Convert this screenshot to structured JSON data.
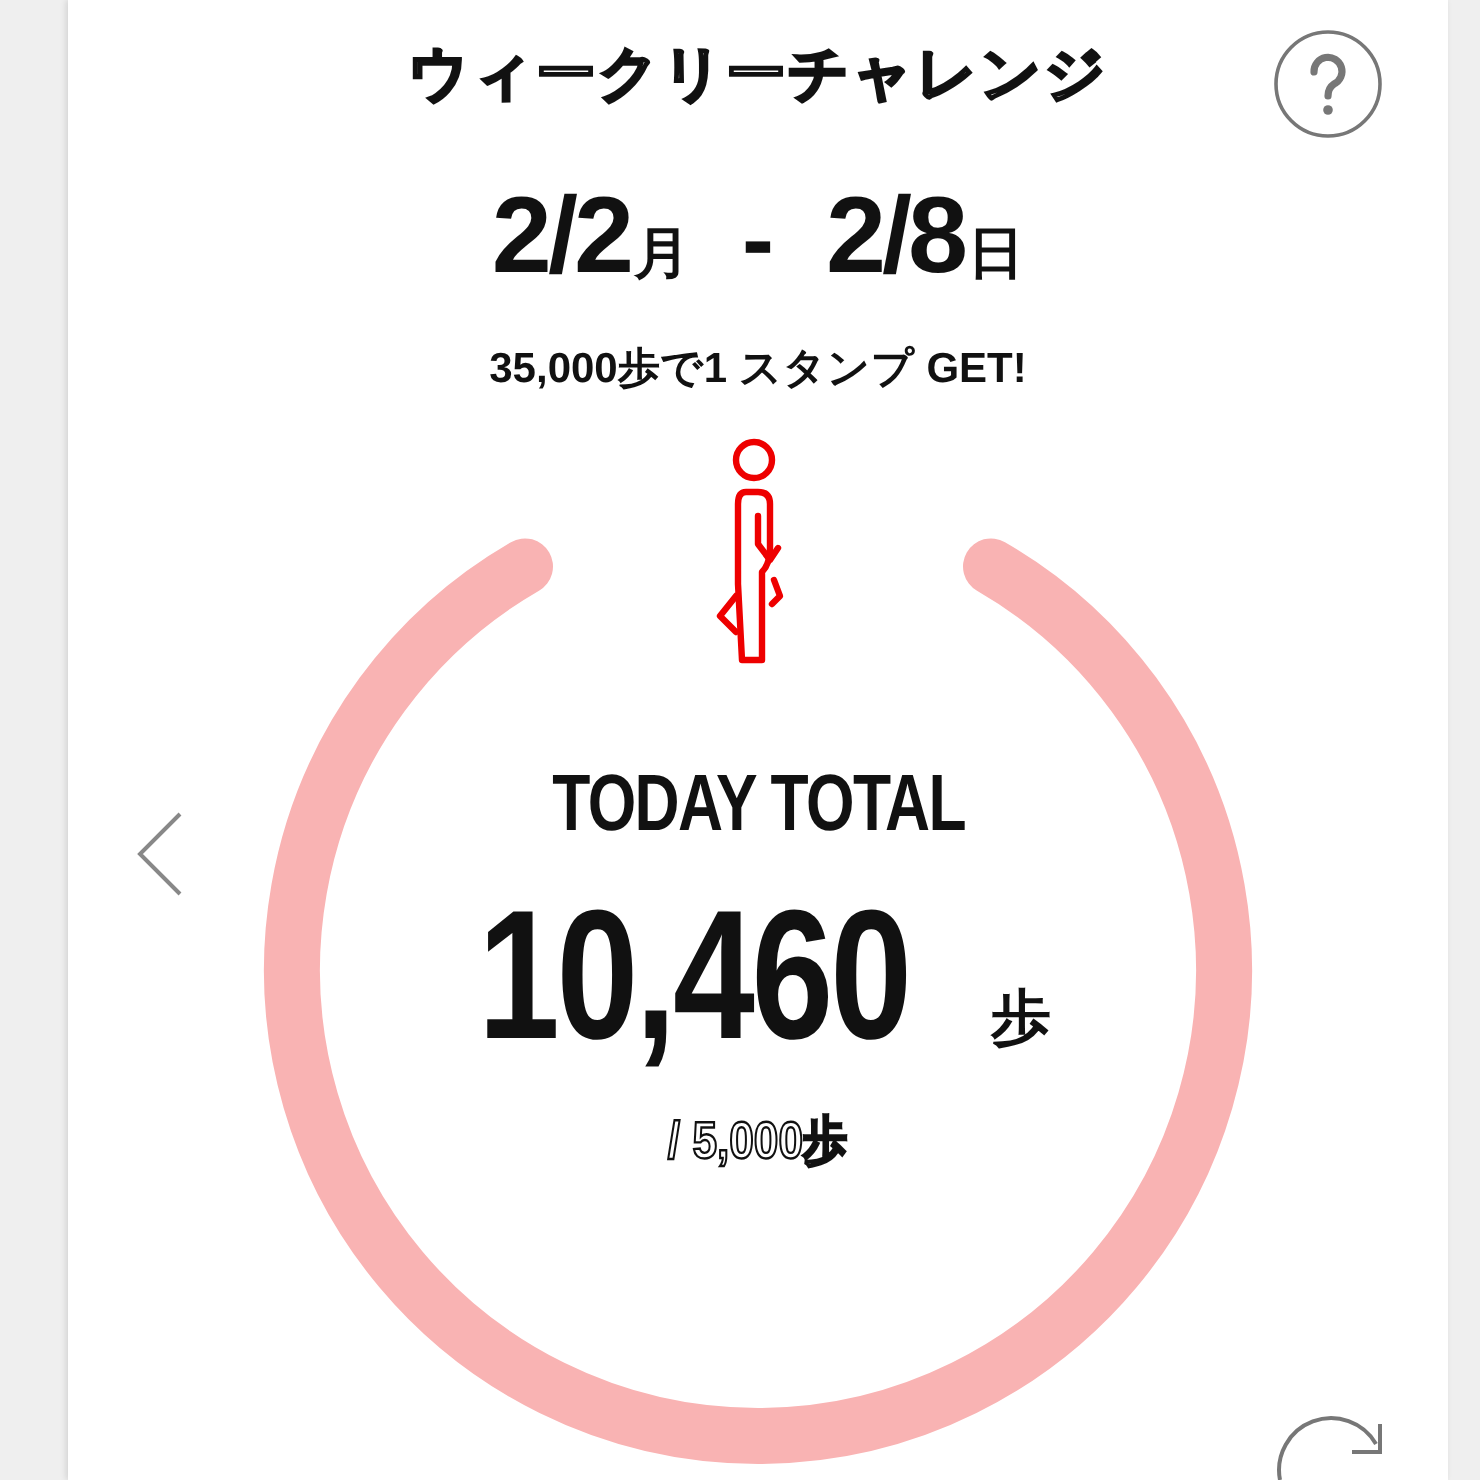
{
  "title": "ウィークリーチャレンジ",
  "date_range": {
    "start": "2/2",
    "start_day": "月",
    "separator": "-",
    "end": "2/8",
    "end_day": "日"
  },
  "goal": "35,000歩で1 スタンプ GET!",
  "today": {
    "label": "TODAY TOTAL",
    "count": "10,460",
    "unit": "歩",
    "target": "/ 5,000歩"
  }
}
